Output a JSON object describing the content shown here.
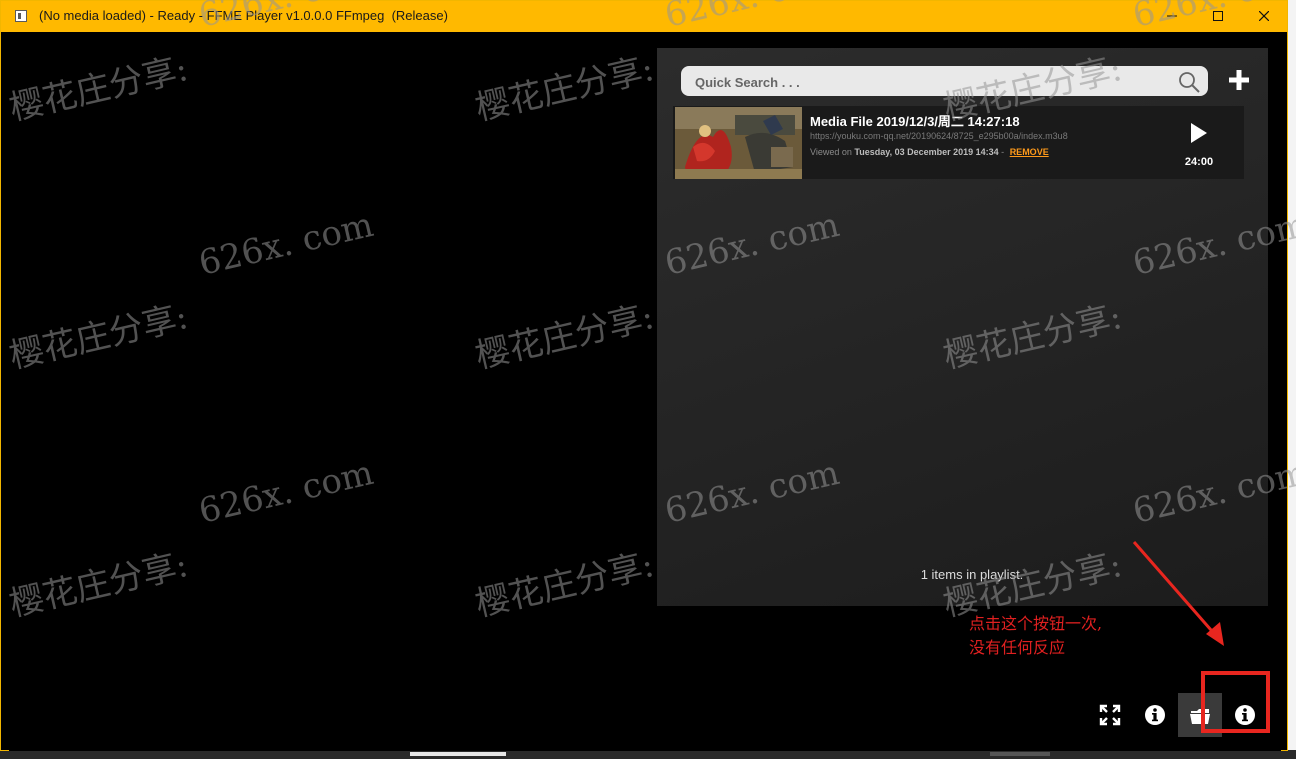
{
  "window": {
    "title": "(No media loaded) - Ready - FFME Player v1.0.0.0 FFmpeg  (Release)",
    "accent_color": "#ffb900",
    "controls": {
      "minimize": "minimize-icon",
      "maximize": "maximize-icon",
      "close": "close-icon"
    }
  },
  "playlist": {
    "search_placeholder": "Quick Search . . .",
    "items": [
      {
        "title": "Media File 2019/12/3/周二 14:27:18",
        "url": "https://youku.com-qq.net/20190624/8725_e295b00a/index.m3u8",
        "viewed_prefix": "Viewed on",
        "viewed_date": "Tuesday, 03 December 2019 14:34",
        "separator": "-",
        "remove_label": "REMOVE",
        "duration": "24:00"
      }
    ],
    "count_text": "1 items in playlist."
  },
  "controls": {
    "buttons": [
      "fullscreen-icon",
      "info-icon",
      "open-icon",
      "info-icon"
    ]
  },
  "annotation": {
    "line1": "点击这个按钮一次,",
    "line2": "没有任何反应",
    "color": "#e02020"
  },
  "watermark": {
    "text_a": "樱花庄分享:",
    "text_b": "626x. com"
  }
}
